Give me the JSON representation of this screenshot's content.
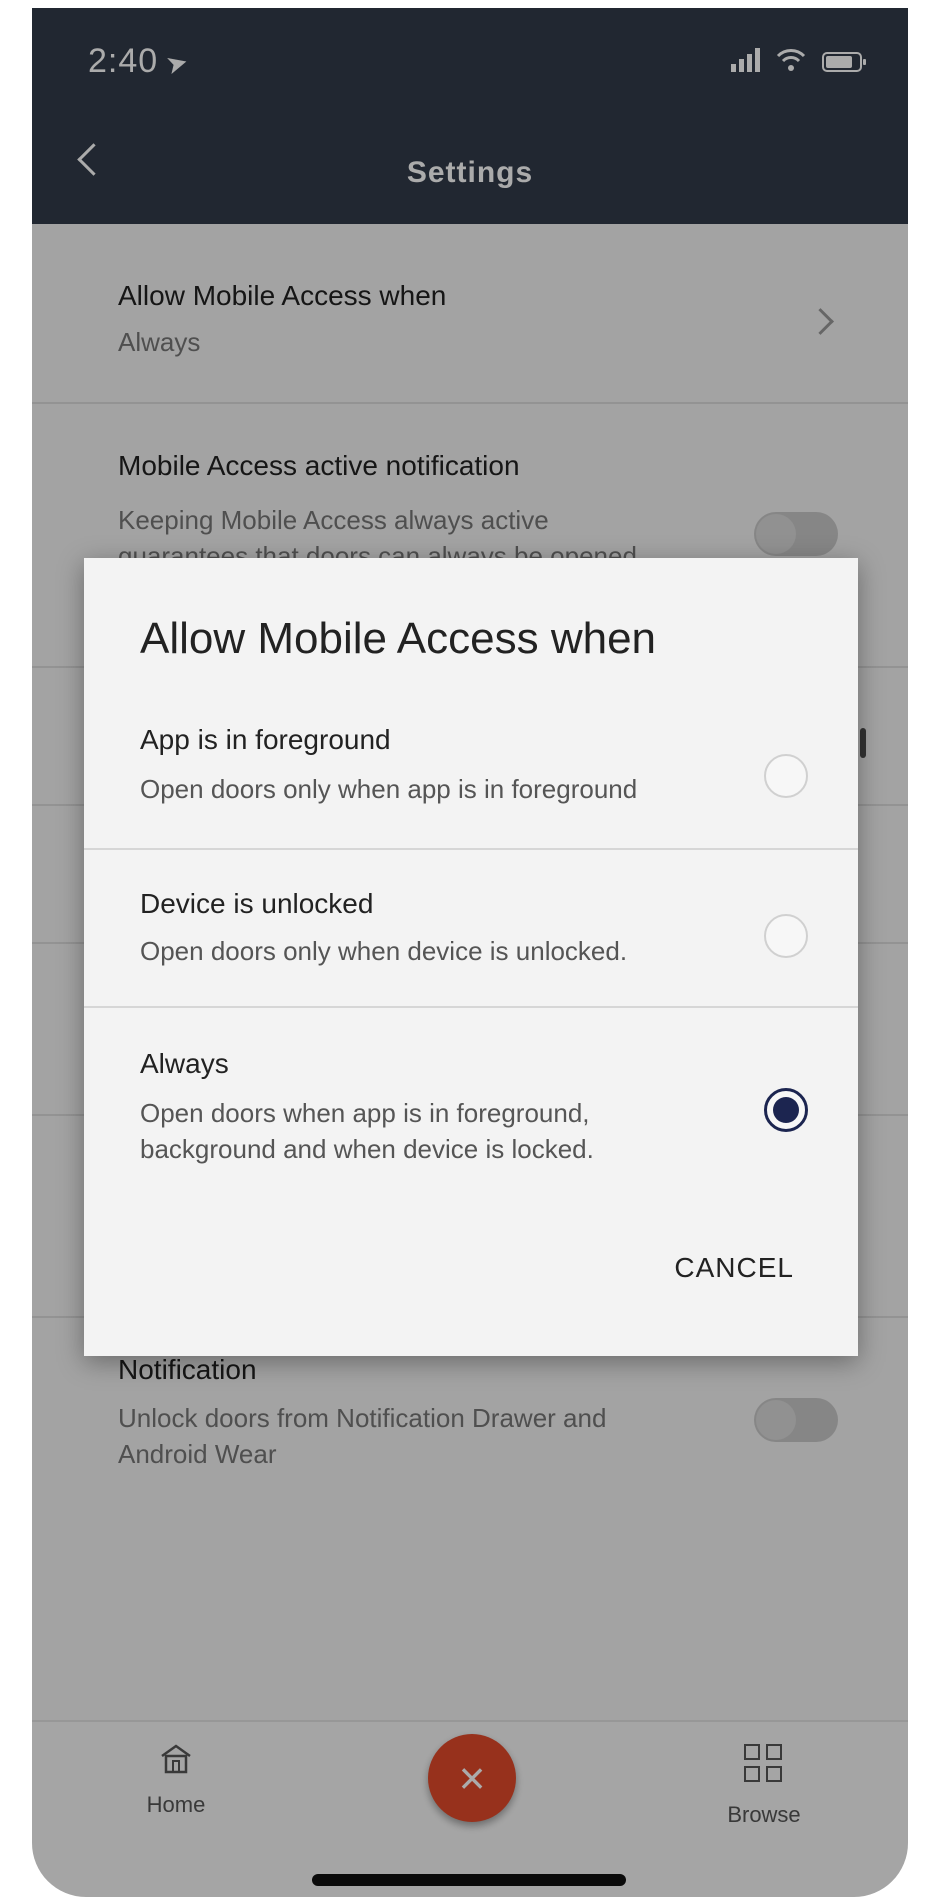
{
  "status_bar": {
    "time": "2:40"
  },
  "nav": {
    "title": "Settings"
  },
  "settings": {
    "allow_access": {
      "title": "Allow Mobile Access when",
      "value": "Always"
    },
    "active_notification": {
      "title": "Mobile Access active notification",
      "desc_line1": "Keeping Mobile Access always active",
      "desc_line2": "guarantees that doors can always be opened"
    },
    "notification": {
      "title": "Notification",
      "desc_line1": "Unlock doors from Notification Drawer and",
      "desc_line2": "Android Wear"
    }
  },
  "tabbar": {
    "home_label": "Home",
    "browse_label": "Browse",
    "fab_glyph": "×"
  },
  "dialog": {
    "title": "Allow Mobile Access when",
    "options": [
      {
        "title": "App is in foreground",
        "desc_line1": "Open doors only when app is in foreground",
        "desc_line2": "",
        "selected": false
      },
      {
        "title": "Device is unlocked",
        "desc_line1": "Open doors only when device is unlocked.",
        "desc_line2": "",
        "selected": false
      },
      {
        "title": "Always",
        "desc_line1": "Open doors when app is in foreground,",
        "desc_line2": "background and when device is locked.",
        "selected": true
      }
    ],
    "cancel_label": "CANCEL"
  },
  "colors": {
    "nav_bar": "#323b4a",
    "accent_radio": "#1c2550",
    "fab": "#e24a2b"
  }
}
